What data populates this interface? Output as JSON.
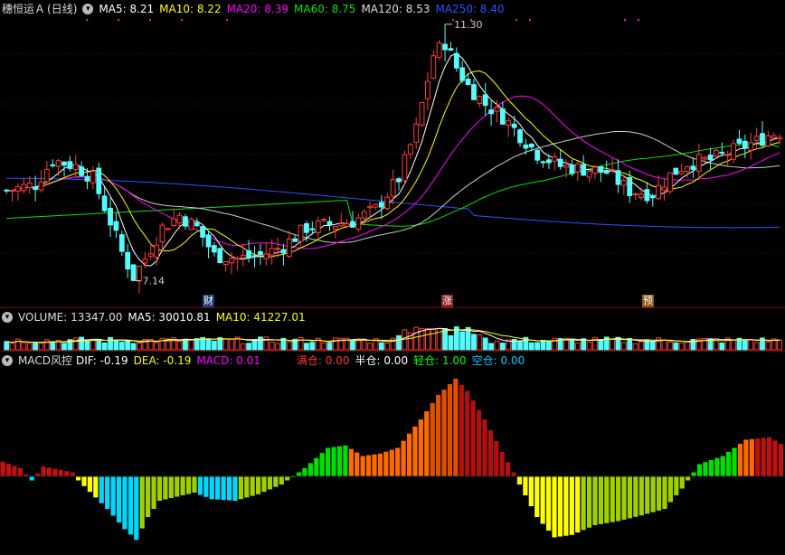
{
  "price_header": {
    "title": "穗恒运Ａ",
    "period": "(日线)",
    "ma5": "MA5: 8.21",
    "ma10": "MA10: 8.22",
    "ma20": "MA20: 8.39",
    "ma60": "MA60: 8.75",
    "ma120": "MA120: 8.53",
    "ma250": "MA250: 8.40"
  },
  "price_annotations": {
    "high": "11.30",
    "low": "7.14"
  },
  "markers": [
    {
      "label": "财",
      "color": "#1e3c78"
    },
    {
      "label": "涨",
      "color": "#8c2020"
    },
    {
      "label": "预",
      "color": "#8c5a10"
    }
  ],
  "volume_header": {
    "volume": "VOLUME: 13347.00",
    "ma5": "MA5: 30010.81",
    "ma10": "MA10: 41227.01"
  },
  "macd_header": {
    "name": "MACD风控",
    "dif": "DIF: -0.19",
    "dea": "DEA: -0.19",
    "macd": "MACD: 0.01",
    "full": "满仓: 0.00",
    "half": "半仓: 0.00",
    "light": "轻仓: 1.00",
    "empty": "空仓: 0.00"
  },
  "colors": {
    "up": "#ff3c3c",
    "down": "#54fcfc",
    "ma5": "#ffffff",
    "ma10": "#ffff00",
    "ma20": "#ff00ff",
    "ma60": "#00e600",
    "ma120": "#cccccc",
    "ma250": "#3050ff",
    "grid": "#7a0000",
    "full": "#ff3030",
    "half": "#ffffff",
    "light": "#00ff00",
    "empty": "#00c8ff"
  },
  "chart_data": [
    {
      "type": "candlestick",
      "series": [
        {
          "name": "穗恒运Ａ",
          "values": []
        }
      ]
    },
    {
      "type": "bar",
      "series": [
        {
          "name": "VOLUME",
          "values": []
        }
      ]
    },
    {
      "type": "bar",
      "series": [
        {
          "name": "MACD",
          "values": []
        }
      ]
    }
  ]
}
